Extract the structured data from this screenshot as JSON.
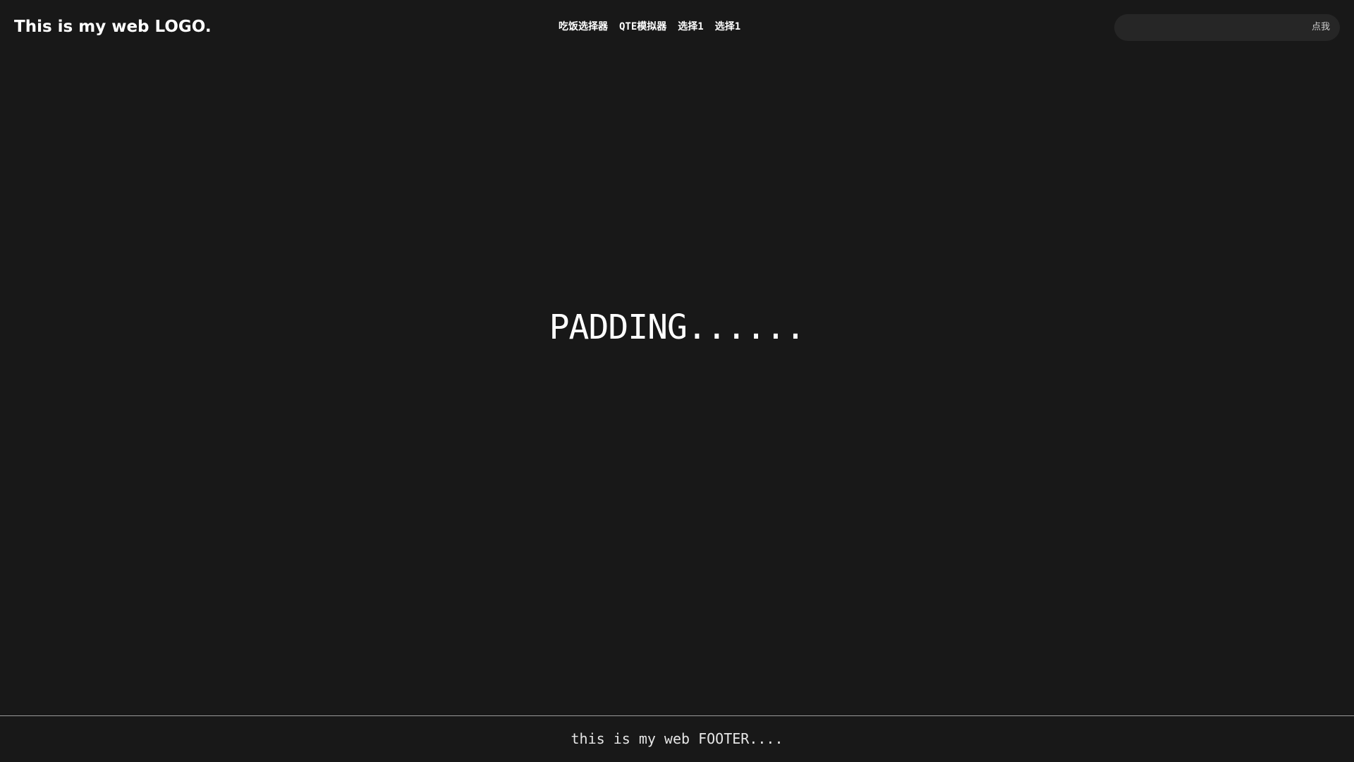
{
  "header": {
    "logo": "This is my web LOGO.",
    "nav": [
      {
        "label": "吃饭选择器"
      },
      {
        "label": "QTE模拟器"
      },
      {
        "label": "选择1"
      },
      {
        "label": "选择1"
      }
    ],
    "search": {
      "value": "",
      "placeholder": "",
      "button_label": "点我"
    }
  },
  "main": {
    "text": "PADDING......"
  },
  "footer": {
    "text": "this is my web FOOTER...."
  },
  "colors": {
    "background": "#181818",
    "search_bg": "#262626",
    "footer_border": "#9a9a9a",
    "text": "#ffffff"
  }
}
